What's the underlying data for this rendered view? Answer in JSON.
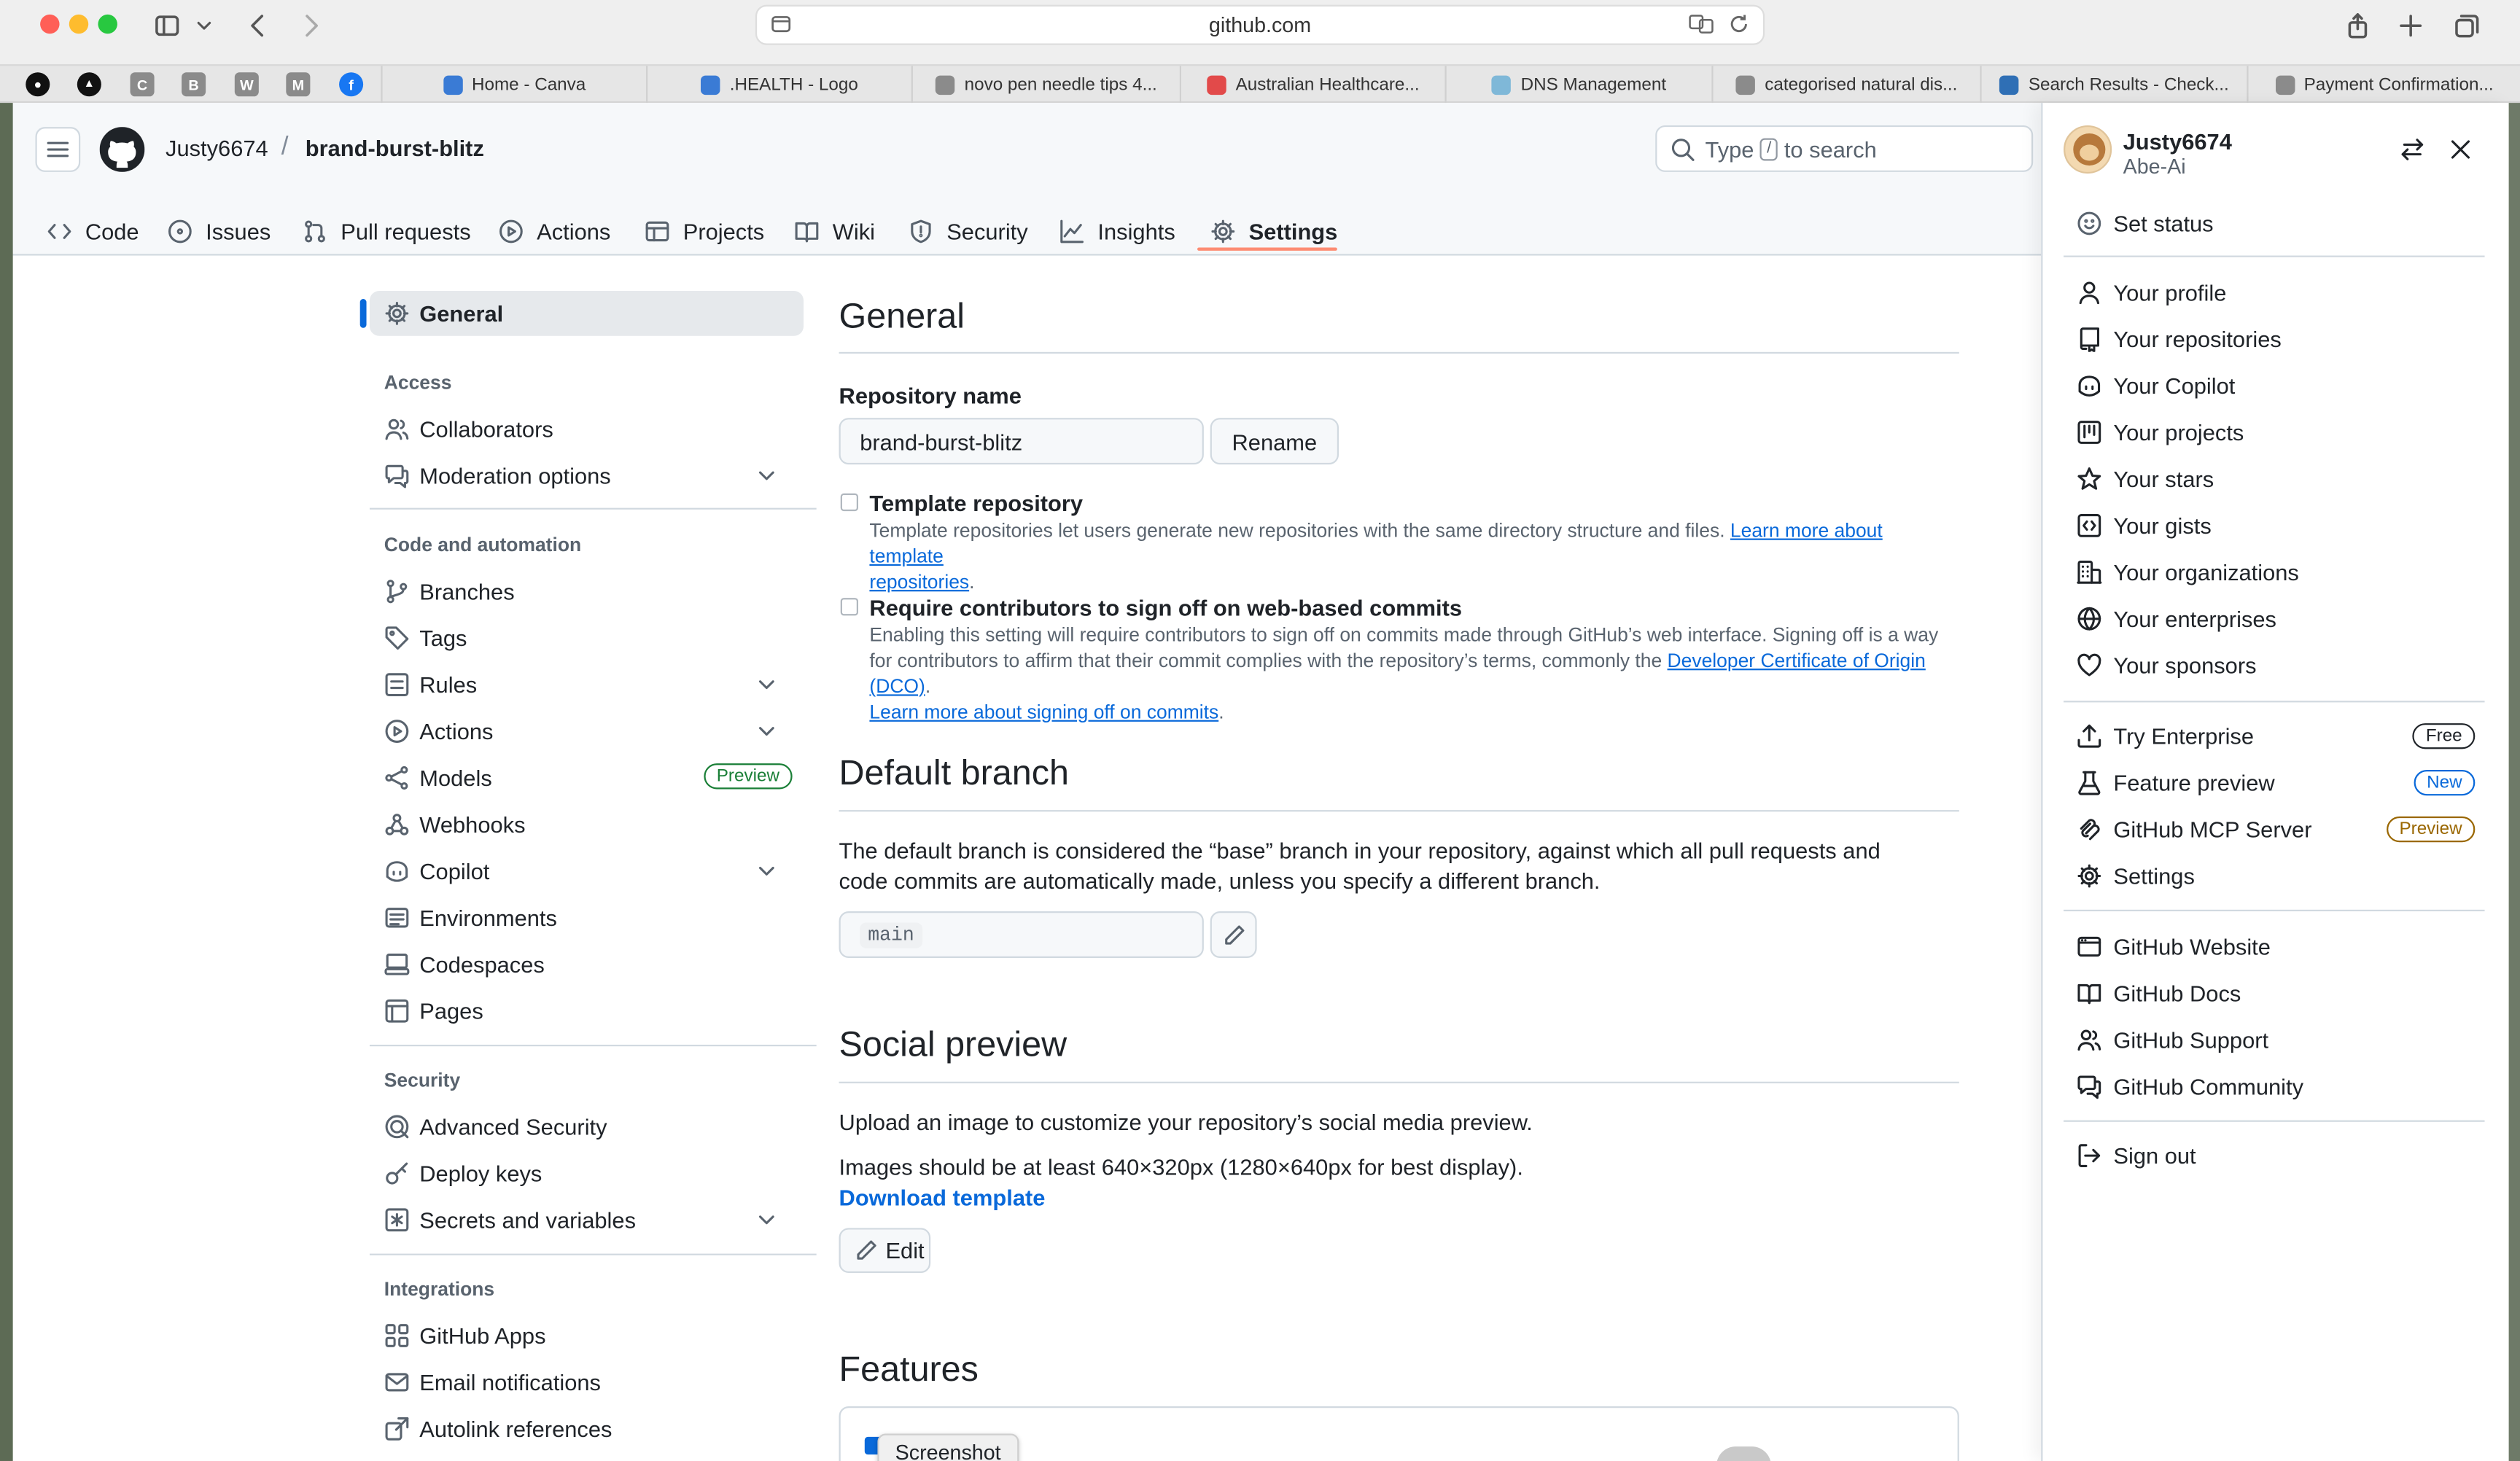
{
  "browser": {
    "url": "github.com",
    "pinned_tabs": [
      {
        "icon": "github-icon",
        "letter": "",
        "color": "#111111"
      },
      {
        "icon": "triangle-app-icon",
        "letter": "",
        "color": "#111111"
      },
      {
        "icon": "letter-c-icon",
        "letter": "C",
        "color": "#8b8b8b"
      },
      {
        "icon": "letter-b-icon",
        "letter": "B",
        "color": "#8b8b8b"
      },
      {
        "icon": "letter-w-icon",
        "letter": "W",
        "color": "#8b8b8b"
      },
      {
        "icon": "letter-m-icon",
        "letter": "M",
        "color": "#8b8b8b"
      },
      {
        "icon": "facebook-icon",
        "letter": "f",
        "color": "#1877f2"
      }
    ],
    "tabs": [
      {
        "title": "Home - Canva",
        "color": "#3a7bd5"
      },
      {
        "title": ".HEALTH - Logo",
        "color": "#3a7bd5"
      },
      {
        "title": "novo pen needle tips 4...",
        "color": "#8b8b8b"
      },
      {
        "title": "Australian Healthcare...",
        "color": "#e24a4a"
      },
      {
        "title": "DNS Management",
        "color": "#7fb8d8"
      },
      {
        "title": "categorised natural dis...",
        "color": "#8b8b8b"
      },
      {
        "title": "Search Results - Check...",
        "color": "#2f6fb5"
      },
      {
        "title": "Payment Confirmation...",
        "color": "#8b8b8b"
      }
    ]
  },
  "header": {
    "owner": "Justy6674",
    "repo": "brand-burst-blitz",
    "search_prefix": "Type",
    "search_key": "/",
    "search_suffix": "to search"
  },
  "repo_nav": [
    {
      "label": "Code",
      "icon": "code-icon"
    },
    {
      "label": "Issues",
      "icon": "issue-icon"
    },
    {
      "label": "Pull requests",
      "icon": "pull-request-icon"
    },
    {
      "label": "Actions",
      "icon": "play-icon"
    },
    {
      "label": "Projects",
      "icon": "table-icon"
    },
    {
      "label": "Wiki",
      "icon": "book-icon"
    },
    {
      "label": "Security",
      "icon": "shield-icon"
    },
    {
      "label": "Insights",
      "icon": "graph-icon"
    },
    {
      "label": "Settings",
      "icon": "gear-icon"
    }
  ],
  "settings_nav": {
    "general": "General",
    "access_heading": "Access",
    "access": [
      "Collaborators",
      "Moderation options"
    ],
    "code_heading": "Code and automation",
    "code": [
      "Branches",
      "Tags",
      "Rules",
      "Actions",
      "Models",
      "Webhooks",
      "Copilot",
      "Environments",
      "Codespaces",
      "Pages"
    ],
    "models_badge": "Preview",
    "security_heading": "Security",
    "security": [
      "Advanced Security",
      "Deploy keys",
      "Secrets and variables"
    ],
    "integrations_heading": "Integrations",
    "integrations": [
      "GitHub Apps",
      "Email notifications",
      "Autolink references"
    ]
  },
  "main": {
    "title": "General",
    "repo_name_label": "Repository name",
    "repo_name_value": "brand-burst-blitz",
    "rename_label": "Rename",
    "template_title": "Template repository",
    "template_desc": "Template repositories let users generate new repositories with the same directory structure and files.",
    "template_link_a": "Learn more about template",
    "template_link_b": "repositories",
    "signoff_title": "Require contributors to sign off on web-based commits",
    "signoff_desc_a": "Enabling this setting will require contributors to sign off on commits made through GitHub’s web interface. Signing off is a way for contributors to affirm that their commit complies with the repository’s terms, commonly the",
    "signoff_link_dco": "Developer Certificate of Origin (DCO)",
    "signoff_link_learn": "Learn more about signing off on commits",
    "default_branch_title": "Default branch",
    "default_branch_desc": "The default branch is considered the “base” branch in your repository, against which all pull requests and code commits are automatically made, unless you specify a different branch.",
    "default_branch_value": "main",
    "social_title": "Social preview",
    "social_desc1": "Upload an image to customize your repository’s social media preview.",
    "social_desc2": "Images should be at least 640×320px (1280×640px for best display).",
    "download_template": "Download template",
    "edit_label": "Edit",
    "features_title": "Features",
    "screenshot_tooltip": "Screenshot"
  },
  "user_panel": {
    "username": "Justy6674",
    "display_name": "Abe-Ai",
    "set_status": "Set status",
    "group1": [
      {
        "label": "Your profile",
        "icon": "person-icon"
      },
      {
        "label": "Your repositories",
        "icon": "repo-icon"
      },
      {
        "label": "Your Copilot",
        "icon": "copilot-icon"
      },
      {
        "label": "Your projects",
        "icon": "project-icon"
      },
      {
        "label": "Your stars",
        "icon": "star-icon"
      },
      {
        "label": "Your gists",
        "icon": "code-square-icon"
      },
      {
        "label": "Your organizations",
        "icon": "organization-icon"
      },
      {
        "label": "Your enterprises",
        "icon": "globe-icon"
      },
      {
        "label": "Your sponsors",
        "icon": "heart-icon"
      }
    ],
    "group2": [
      {
        "label": "Try Enterprise",
        "icon": "upload-icon",
        "badge": "Free",
        "badge_color": "#1f2328"
      },
      {
        "label": "Feature preview",
        "icon": "beaker-icon",
        "badge": "New",
        "badge_color": "#0969da"
      },
      {
        "label": "GitHub MCP Server",
        "icon": "mcp-icon",
        "badge": "Preview",
        "badge_color": "#9a6700"
      },
      {
        "label": "Settings",
        "icon": "gear-icon",
        "badge": "",
        "badge_color": ""
      }
    ],
    "group3": [
      {
        "label": "GitHub Website",
        "icon": "browser-icon"
      },
      {
        "label": "GitHub Docs",
        "icon": "book-icon"
      },
      {
        "label": "GitHub Support",
        "icon": "people-icon"
      },
      {
        "label": "GitHub Community",
        "icon": "comment-icon"
      }
    ],
    "sign_out": "Sign out"
  }
}
